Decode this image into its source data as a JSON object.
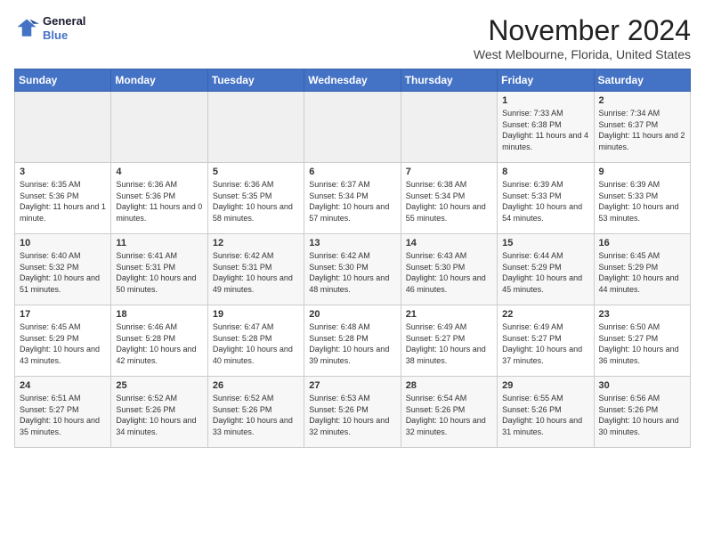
{
  "header": {
    "logo_line1": "General",
    "logo_line2": "Blue",
    "month": "November 2024",
    "location": "West Melbourne, Florida, United States"
  },
  "weekdays": [
    "Sunday",
    "Monday",
    "Tuesday",
    "Wednesday",
    "Thursday",
    "Friday",
    "Saturday"
  ],
  "weeks": [
    [
      {
        "day": "",
        "info": ""
      },
      {
        "day": "",
        "info": ""
      },
      {
        "day": "",
        "info": ""
      },
      {
        "day": "",
        "info": ""
      },
      {
        "day": "",
        "info": ""
      },
      {
        "day": "1",
        "info": "Sunrise: 7:33 AM\nSunset: 6:38 PM\nDaylight: 11 hours and 4 minutes."
      },
      {
        "day": "2",
        "info": "Sunrise: 7:34 AM\nSunset: 6:37 PM\nDaylight: 11 hours and 2 minutes."
      }
    ],
    [
      {
        "day": "3",
        "info": "Sunrise: 6:35 AM\nSunset: 5:36 PM\nDaylight: 11 hours and 1 minute."
      },
      {
        "day": "4",
        "info": "Sunrise: 6:36 AM\nSunset: 5:36 PM\nDaylight: 11 hours and 0 minutes."
      },
      {
        "day": "5",
        "info": "Sunrise: 6:36 AM\nSunset: 5:35 PM\nDaylight: 10 hours and 58 minutes."
      },
      {
        "day": "6",
        "info": "Sunrise: 6:37 AM\nSunset: 5:34 PM\nDaylight: 10 hours and 57 minutes."
      },
      {
        "day": "7",
        "info": "Sunrise: 6:38 AM\nSunset: 5:34 PM\nDaylight: 10 hours and 55 minutes."
      },
      {
        "day": "8",
        "info": "Sunrise: 6:39 AM\nSunset: 5:33 PM\nDaylight: 10 hours and 54 minutes."
      },
      {
        "day": "9",
        "info": "Sunrise: 6:39 AM\nSunset: 5:33 PM\nDaylight: 10 hours and 53 minutes."
      }
    ],
    [
      {
        "day": "10",
        "info": "Sunrise: 6:40 AM\nSunset: 5:32 PM\nDaylight: 10 hours and 51 minutes."
      },
      {
        "day": "11",
        "info": "Sunrise: 6:41 AM\nSunset: 5:31 PM\nDaylight: 10 hours and 50 minutes."
      },
      {
        "day": "12",
        "info": "Sunrise: 6:42 AM\nSunset: 5:31 PM\nDaylight: 10 hours and 49 minutes."
      },
      {
        "day": "13",
        "info": "Sunrise: 6:42 AM\nSunset: 5:30 PM\nDaylight: 10 hours and 48 minutes."
      },
      {
        "day": "14",
        "info": "Sunrise: 6:43 AM\nSunset: 5:30 PM\nDaylight: 10 hours and 46 minutes."
      },
      {
        "day": "15",
        "info": "Sunrise: 6:44 AM\nSunset: 5:29 PM\nDaylight: 10 hours and 45 minutes."
      },
      {
        "day": "16",
        "info": "Sunrise: 6:45 AM\nSunset: 5:29 PM\nDaylight: 10 hours and 44 minutes."
      }
    ],
    [
      {
        "day": "17",
        "info": "Sunrise: 6:45 AM\nSunset: 5:29 PM\nDaylight: 10 hours and 43 minutes."
      },
      {
        "day": "18",
        "info": "Sunrise: 6:46 AM\nSunset: 5:28 PM\nDaylight: 10 hours and 42 minutes."
      },
      {
        "day": "19",
        "info": "Sunrise: 6:47 AM\nSunset: 5:28 PM\nDaylight: 10 hours and 40 minutes."
      },
      {
        "day": "20",
        "info": "Sunrise: 6:48 AM\nSunset: 5:28 PM\nDaylight: 10 hours and 39 minutes."
      },
      {
        "day": "21",
        "info": "Sunrise: 6:49 AM\nSunset: 5:27 PM\nDaylight: 10 hours and 38 minutes."
      },
      {
        "day": "22",
        "info": "Sunrise: 6:49 AM\nSunset: 5:27 PM\nDaylight: 10 hours and 37 minutes."
      },
      {
        "day": "23",
        "info": "Sunrise: 6:50 AM\nSunset: 5:27 PM\nDaylight: 10 hours and 36 minutes."
      }
    ],
    [
      {
        "day": "24",
        "info": "Sunrise: 6:51 AM\nSunset: 5:27 PM\nDaylight: 10 hours and 35 minutes."
      },
      {
        "day": "25",
        "info": "Sunrise: 6:52 AM\nSunset: 5:26 PM\nDaylight: 10 hours and 34 minutes."
      },
      {
        "day": "26",
        "info": "Sunrise: 6:52 AM\nSunset: 5:26 PM\nDaylight: 10 hours and 33 minutes."
      },
      {
        "day": "27",
        "info": "Sunrise: 6:53 AM\nSunset: 5:26 PM\nDaylight: 10 hours and 32 minutes."
      },
      {
        "day": "28",
        "info": "Sunrise: 6:54 AM\nSunset: 5:26 PM\nDaylight: 10 hours and 32 minutes."
      },
      {
        "day": "29",
        "info": "Sunrise: 6:55 AM\nSunset: 5:26 PM\nDaylight: 10 hours and 31 minutes."
      },
      {
        "day": "30",
        "info": "Sunrise: 6:56 AM\nSunset: 5:26 PM\nDaylight: 10 hours and 30 minutes."
      }
    ]
  ]
}
